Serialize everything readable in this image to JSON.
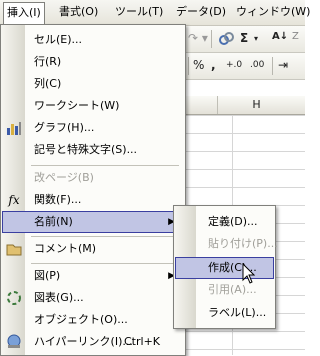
{
  "menubar": {
    "items": [
      {
        "label": "挿入(I)"
      },
      {
        "label": "書式(O)"
      },
      {
        "label": "ツール(T)"
      },
      {
        "label": "データ(D)"
      },
      {
        "label": "ウィンドウ(W)"
      }
    ]
  },
  "toolbar": {
    "sigma": "Σ",
    "percent": "%",
    "comma": ",",
    "inc_decimal": "+.0",
    "dec_decimal": ".00",
    "indent": "⇥"
  },
  "sheet": {
    "columns": [
      "G",
      "H"
    ]
  },
  "insert_menu": {
    "items": [
      {
        "label": "セル(E)...",
        "enabled": true,
        "icon": ""
      },
      {
        "label": "行(R)",
        "enabled": true,
        "icon": ""
      },
      {
        "label": "列(C)",
        "enabled": true,
        "icon": ""
      },
      {
        "label": "ワークシート(W)",
        "enabled": true,
        "icon": ""
      },
      {
        "label": "グラフ(H)...",
        "enabled": true,
        "icon": "chart-icon"
      },
      {
        "label": "記号と特殊文字(S)...",
        "enabled": true,
        "icon": ""
      },
      {
        "label": "改ページ(B)",
        "enabled": false,
        "icon": ""
      },
      {
        "label": "関数(F)...",
        "enabled": true,
        "icon": "function-icon",
        "icon_text": "fx"
      },
      {
        "label": "名前(N)",
        "enabled": true,
        "icon": "",
        "submenu": true,
        "highlighted": true
      },
      {
        "label": "コメント(M)",
        "enabled": true,
        "icon": "comment-icon"
      },
      {
        "label": "図(P)",
        "enabled": true,
        "icon": "",
        "submenu": true
      },
      {
        "label": "図表(G)...",
        "enabled": true,
        "icon": "diagram-icon"
      },
      {
        "label": "オブジェクト(O)...",
        "enabled": true,
        "icon": ""
      },
      {
        "label": "ハイパーリンク(I)...",
        "enabled": true,
        "icon": "hyperlink-icon",
        "shortcut": "Ctrl+K"
      }
    ]
  },
  "name_submenu": {
    "items": [
      {
        "label": "定義(D)...",
        "enabled": true
      },
      {
        "label": "貼り付け(P)...",
        "enabled": false
      },
      {
        "label": "作成(C)...",
        "enabled": true,
        "highlighted": true
      },
      {
        "label": "引用(A)...",
        "enabled": false
      },
      {
        "label": "ラベル(L)...",
        "enabled": true
      }
    ]
  },
  "colors": {
    "highlight_fill": "#c1c5e4",
    "highlight_border": "#3a3fa0",
    "disabled_text": "#a09f99"
  }
}
